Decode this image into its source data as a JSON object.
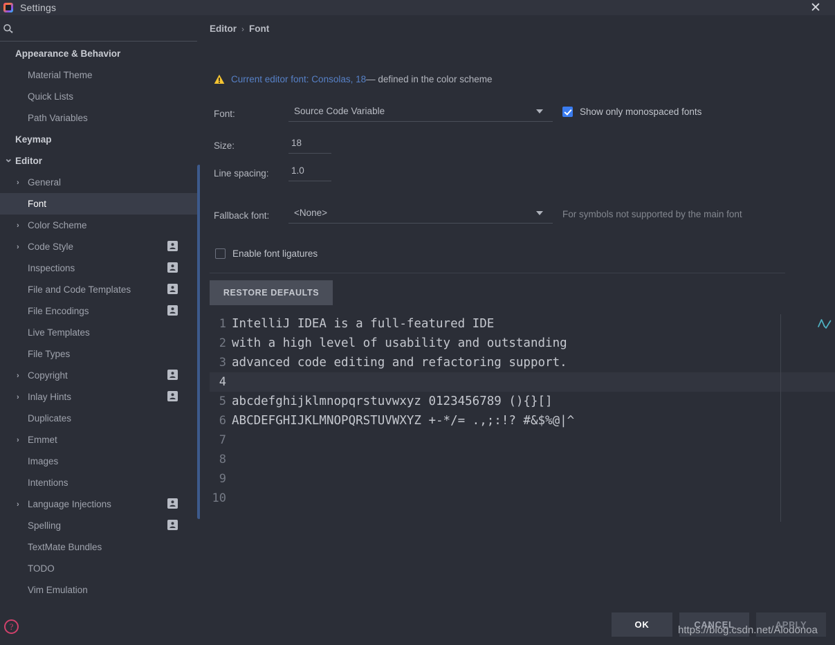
{
  "window": {
    "title": "Settings",
    "logo_icon": "intellij-logo-icon",
    "close_icon": "close-icon"
  },
  "search": {
    "icon": "search-icon",
    "placeholder": "",
    "value": ""
  },
  "sidebar": {
    "items": [
      {
        "label": "Appearance & Behavior",
        "level": 0,
        "group": true,
        "arrow": "",
        "badge": false,
        "selected": false
      },
      {
        "label": "Material Theme",
        "level": 1,
        "group": false,
        "arrow": "",
        "badge": false,
        "selected": false
      },
      {
        "label": "Quick Lists",
        "level": 1,
        "group": false,
        "arrow": "",
        "badge": false,
        "selected": false
      },
      {
        "label": "Path Variables",
        "level": 1,
        "group": false,
        "arrow": "",
        "badge": false,
        "selected": false
      },
      {
        "label": "Keymap",
        "level": 0,
        "group": true,
        "arrow": "",
        "badge": false,
        "selected": false
      },
      {
        "label": "Editor",
        "level": 0,
        "group": true,
        "arrow": "v",
        "badge": false,
        "selected": false
      },
      {
        "label": "General",
        "level": 1,
        "group": false,
        "arrow": ">",
        "badge": false,
        "selected": false
      },
      {
        "label": "Font",
        "level": 1,
        "group": false,
        "arrow": "",
        "badge": false,
        "selected": true
      },
      {
        "label": "Color Scheme",
        "level": 1,
        "group": false,
        "arrow": ">",
        "badge": false,
        "selected": false
      },
      {
        "label": "Code Style",
        "level": 1,
        "group": false,
        "arrow": ">",
        "badge": true,
        "selected": false
      },
      {
        "label": "Inspections",
        "level": 1,
        "group": false,
        "arrow": "",
        "badge": true,
        "selected": false
      },
      {
        "label": "File and Code Templates",
        "level": 1,
        "group": false,
        "arrow": "",
        "badge": true,
        "selected": false
      },
      {
        "label": "File Encodings",
        "level": 1,
        "group": false,
        "arrow": "",
        "badge": true,
        "selected": false
      },
      {
        "label": "Live Templates",
        "level": 1,
        "group": false,
        "arrow": "",
        "badge": false,
        "selected": false
      },
      {
        "label": "File Types",
        "level": 1,
        "group": false,
        "arrow": "",
        "badge": false,
        "selected": false
      },
      {
        "label": "Copyright",
        "level": 1,
        "group": false,
        "arrow": ">",
        "badge": true,
        "selected": false
      },
      {
        "label": "Inlay Hints",
        "level": 1,
        "group": false,
        "arrow": ">",
        "badge": true,
        "selected": false
      },
      {
        "label": "Duplicates",
        "level": 1,
        "group": false,
        "arrow": "",
        "badge": false,
        "selected": false
      },
      {
        "label": "Emmet",
        "level": 1,
        "group": false,
        "arrow": ">",
        "badge": false,
        "selected": false
      },
      {
        "label": "Images",
        "level": 1,
        "group": false,
        "arrow": "",
        "badge": false,
        "selected": false
      },
      {
        "label": "Intentions",
        "level": 1,
        "group": false,
        "arrow": "",
        "badge": false,
        "selected": false
      },
      {
        "label": "Language Injections",
        "level": 1,
        "group": false,
        "arrow": ">",
        "badge": true,
        "selected": false
      },
      {
        "label": "Spelling",
        "level": 1,
        "group": false,
        "arrow": "",
        "badge": true,
        "selected": false
      },
      {
        "label": "TextMate Bundles",
        "level": 1,
        "group": false,
        "arrow": "",
        "badge": false,
        "selected": false
      },
      {
        "label": "TODO",
        "level": 1,
        "group": false,
        "arrow": "",
        "badge": false,
        "selected": false
      },
      {
        "label": "Vim Emulation",
        "level": 1,
        "group": false,
        "arrow": "",
        "badge": false,
        "selected": false
      }
    ],
    "help_icon": "help-icon",
    "help_label": "?"
  },
  "breadcrumb": {
    "parent": "Editor",
    "separator": "›",
    "current": "Font"
  },
  "notice": {
    "warning_icon": "warning-triangle-icon",
    "link": "Current editor font: Consolas, 18",
    "rest": " — defined in the color scheme"
  },
  "form": {
    "font_label": "Font:",
    "font_value": "Source Code Variable",
    "size_label": "Size:",
    "size_value": "18",
    "line_spacing_label": "Line spacing:",
    "line_spacing_value": "1.0",
    "fallback_label": "Fallback font:",
    "fallback_value": "<None>",
    "fallback_hint": "For symbols not supported by the main font",
    "monospaced_label": "Show only monospaced fonts",
    "monospaced_checked": true,
    "ligatures_label": "Enable font ligatures",
    "ligatures_checked": false,
    "restore_defaults_label": "RESTORE DEFAULTS",
    "dropdown_icon": "chevron-down-icon"
  },
  "preview": {
    "spellcheck_icon": "spellcheck-icon",
    "lines": [
      {
        "num": "1",
        "text": "IntelliJ IDEA is a full-featured IDE",
        "caret": false
      },
      {
        "num": "2",
        "text": "with a high level of usability and outstanding",
        "caret": false
      },
      {
        "num": "3",
        "text": "advanced code editing and refactoring support.",
        "caret": false
      },
      {
        "num": "4",
        "text": "",
        "caret": true
      },
      {
        "num": "5",
        "text": "abcdefghijklmnopqrstuvwxyz 0123456789 (){}[]",
        "caret": false
      },
      {
        "num": "6",
        "text": "ABCDEFGHIJKLMNOPQRSTUVWXYZ +-*/= .,;:!? #&$%@|^",
        "caret": false
      },
      {
        "num": "7",
        "text": "",
        "caret": false
      },
      {
        "num": "8",
        "text": "",
        "caret": false
      },
      {
        "num": "9",
        "text": "",
        "caret": false
      },
      {
        "num": "10",
        "text": "",
        "caret": false
      }
    ]
  },
  "buttons": {
    "ok": "OK",
    "cancel": "CANCEL",
    "apply": "APPLY"
  },
  "watermark": "https://blog.csdn.net/Alodonoa",
  "colors": {
    "background": "#2b2e37",
    "titlebar": "#31343e",
    "selected_row": "#393d49",
    "accent_blue": "#3a7cf0",
    "link_blue": "#5781c7",
    "scrollbar_blue": "#3d5a8c",
    "warning_yellow": "#f5c431",
    "help_pink": "#d0416b",
    "spellcheck_teal": "#4fb3c4"
  }
}
